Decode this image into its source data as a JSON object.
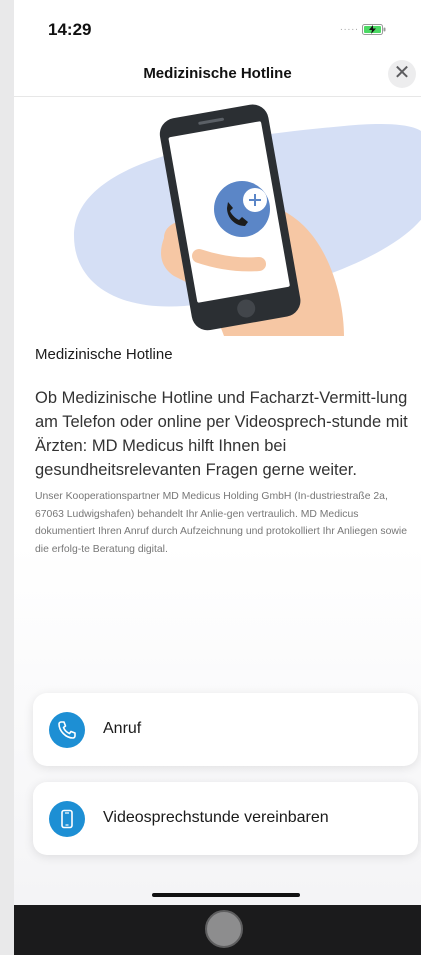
{
  "status_bar": {
    "time": "14:29",
    "signal": "....."
  },
  "header": {
    "title": "Medizinische Hotline",
    "close_glyph": "✕"
  },
  "content": {
    "title": "Medizinische Hotline",
    "lead": "Ob Medizinische Hotline und Facharzt-Vermitt-lung am Telefon oder online per Videosprech-stunde mit Ärzten: MD Medicus hilft Ihnen bei gesundheitsrelevanten Fragen gerne weiter.",
    "fine_print": "Unser Kooperationspartner MD Medicus Holding GmbH (In-dustriestraße 2a, 67063 Ludwigshafen) behandelt Ihr Anlie-gen vertraulich. MD Medicus dokumentiert Ihren Anruf durch Aufzeichnung und protokolliert Ihr Anliegen sowie die erfolg-te Beratung digital."
  },
  "actions": [
    {
      "label": "Anruf",
      "icon": "phone-icon"
    },
    {
      "label": "Videosprechstunde vereinbaren",
      "icon": "smartphone-icon"
    }
  ],
  "colors": {
    "accent": "#1d8fd4",
    "illustration_blob": "#d5dff5",
    "hand": "#f6c7a4",
    "phone_body": "#2b2f33",
    "battery": "#4cd964"
  }
}
